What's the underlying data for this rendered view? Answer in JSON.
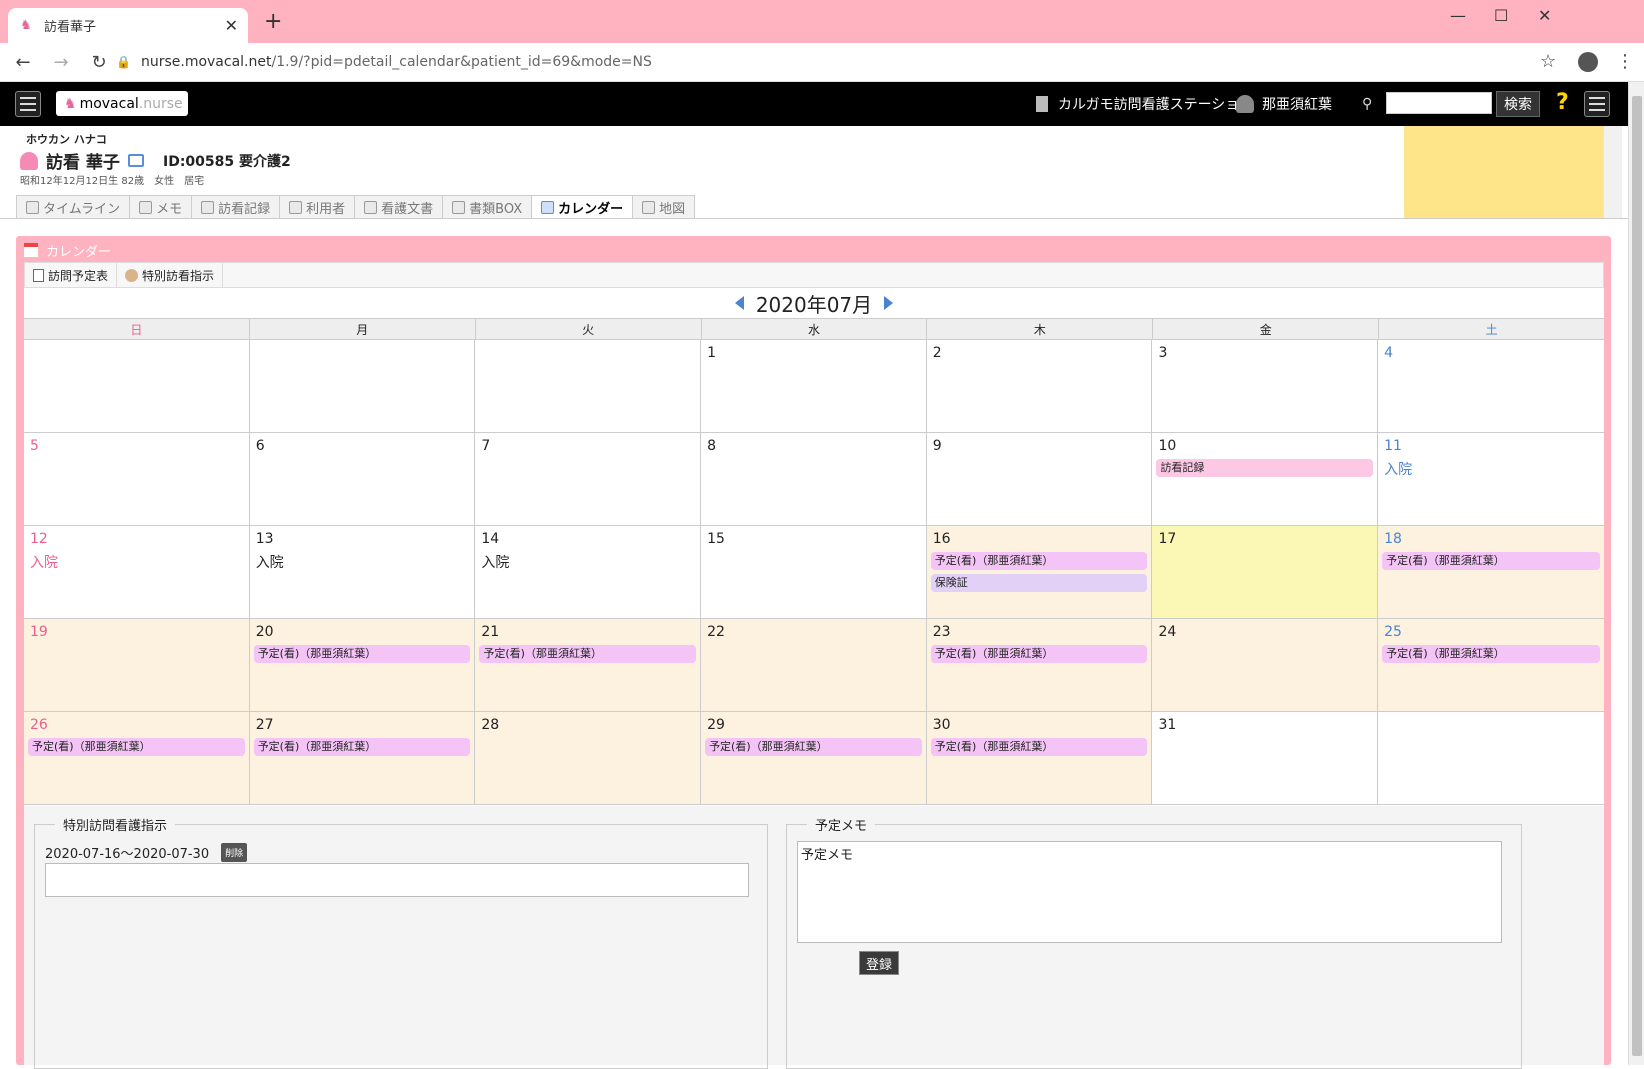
{
  "browser": {
    "tab_title": "訪看華子",
    "url_host": "nurse.movacal.net",
    "url_path": "/1.9/?pid=pdetail_calendar&patient_id=69&mode=NS"
  },
  "header": {
    "logo_main": "movacal",
    "logo_sub": ".nurse",
    "station": "カルガモ訪問看護ステーション",
    "user": "那亜須紅葉",
    "search_button": "検索",
    "help": "?"
  },
  "patient": {
    "kana": "ホウカン ハナコ",
    "name": "訪看 華子",
    "id_line": "ID:00585 要介護2",
    "birth": "昭和12年12月12日生 82歳",
    "sex": "女性",
    "residence": "居宅"
  },
  "tabs": [
    "タイムライン",
    "メモ",
    "訪看記録",
    "利用者",
    "看護文書",
    "書類BOX",
    "カレンダー",
    "地図"
  ],
  "panel": {
    "title": "カレンダー",
    "tool_schedule": "訪問予定表",
    "tool_special": "特別訪看指示"
  },
  "calendar": {
    "month": "2020年07月",
    "dow": [
      "日",
      "月",
      "火",
      "水",
      "木",
      "金",
      "土"
    ],
    "weeks": [
      [
        {
          "day": "",
          "events": []
        },
        {
          "day": "",
          "events": []
        },
        {
          "day": "",
          "events": []
        },
        {
          "day": "1",
          "events": []
        },
        {
          "day": "2",
          "events": []
        },
        {
          "day": "3",
          "events": []
        },
        {
          "day": "4",
          "events": []
        }
      ],
      [
        {
          "day": "5",
          "events": []
        },
        {
          "day": "6",
          "events": []
        },
        {
          "day": "7",
          "events": []
        },
        {
          "day": "8",
          "events": []
        },
        {
          "day": "9",
          "events": []
        },
        {
          "day": "10",
          "events": [
            {
              "text": "訪看記録",
              "style": "pink"
            }
          ]
        },
        {
          "day": "11",
          "text": "入院",
          "events": []
        }
      ],
      [
        {
          "day": "12",
          "text": "入院",
          "events": []
        },
        {
          "day": "13",
          "text": "入院",
          "events": []
        },
        {
          "day": "14",
          "text": "入院",
          "events": []
        },
        {
          "day": "15",
          "events": []
        },
        {
          "day": "16",
          "tinted": true,
          "events": [
            {
              "text": "予定(看)（那亜須紅葉）",
              "style": "violet"
            },
            {
              "text": "保険証",
              "style": "purple"
            }
          ]
        },
        {
          "day": "17",
          "today": true,
          "events": []
        },
        {
          "day": "18",
          "tinted": true,
          "events": [
            {
              "text": "予定(看)（那亜須紅葉）",
              "style": "violet"
            }
          ]
        }
      ],
      [
        {
          "day": "19",
          "tinted": true,
          "events": []
        },
        {
          "day": "20",
          "tinted": true,
          "events": [
            {
              "text": "予定(看)（那亜須紅葉）",
              "style": "violet"
            }
          ]
        },
        {
          "day": "21",
          "tinted": true,
          "events": [
            {
              "text": "予定(看)（那亜須紅葉）",
              "style": "violet"
            }
          ]
        },
        {
          "day": "22",
          "tinted": true,
          "events": []
        },
        {
          "day": "23",
          "tinted": true,
          "events": [
            {
              "text": "予定(看)（那亜須紅葉）",
              "style": "violet"
            }
          ]
        },
        {
          "day": "24",
          "tinted": true,
          "events": []
        },
        {
          "day": "25",
          "tinted": true,
          "events": [
            {
              "text": "予定(看)（那亜須紅葉）",
              "style": "violet"
            }
          ]
        }
      ],
      [
        {
          "day": "26",
          "tinted": true,
          "events": [
            {
              "text": "予定(看)（那亜須紅葉）",
              "style": "violet"
            }
          ]
        },
        {
          "day": "27",
          "tinted": true,
          "events": [
            {
              "text": "予定(看)（那亜須紅葉）",
              "style": "violet"
            }
          ]
        },
        {
          "day": "28",
          "tinted": true,
          "events": []
        },
        {
          "day": "29",
          "tinted": true,
          "events": [
            {
              "text": "予定(看)（那亜須紅葉）",
              "style": "violet"
            }
          ]
        },
        {
          "day": "30",
          "tinted": true,
          "events": [
            {
              "text": "予定(看)（那亜須紅葉）",
              "style": "violet"
            }
          ]
        },
        {
          "day": "31",
          "events": []
        },
        {
          "day": "",
          "events": []
        }
      ]
    ]
  },
  "special": {
    "legend": "特別訪問看護指示",
    "range": "2020-07-16～2020-07-30",
    "delete": "削除"
  },
  "memo": {
    "legend": "予定メモ",
    "value": "予定メモ",
    "register": "登録"
  },
  "colors": {
    "tab_bar": "#ffb3c1",
    "panel": "#ffb3c1",
    "sunday": "#ea5f8e",
    "saturday": "#4a84cf",
    "event": "#f3c4f5",
    "today": "#fbf7b5",
    "tinted": "#fdf1e0"
  }
}
